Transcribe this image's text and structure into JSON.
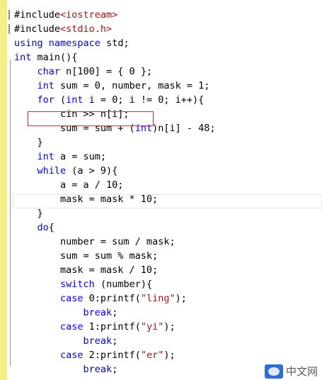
{
  "editor": {
    "lines": [
      [
        {
          "t": "#include"
        },
        {
          "t": "<iostream>",
          "c": "str"
        }
      ],
      [
        {
          "t": "#include"
        },
        {
          "t": "<stdio.h>",
          "c": "str"
        }
      ],
      [
        {
          "t": "using",
          "c": "kw"
        },
        {
          "t": " "
        },
        {
          "t": "namespace",
          "c": "kw"
        },
        {
          "t": " std;"
        }
      ],
      [
        {
          "t": "int",
          "c": "kw"
        },
        {
          "t": " main(){"
        }
      ],
      [
        {
          "t": "    "
        },
        {
          "t": "char",
          "c": "kw"
        },
        {
          "t": " n[100] = { 0 };"
        }
      ],
      [
        {
          "t": "    "
        },
        {
          "t": "int",
          "c": "kw"
        },
        {
          "t": " sum = 0, number, mask = 1;"
        }
      ],
      [
        {
          "t": "    "
        },
        {
          "t": "for",
          "c": "kw"
        },
        {
          "t": " ("
        },
        {
          "t": "int",
          "c": "kw"
        },
        {
          "t": " i = 0; i != 0; i++){"
        }
      ],
      [
        {
          "t": "        cin >> n[i];"
        }
      ],
      [
        {
          "t": "        sum = sum + ("
        },
        {
          "t": "int",
          "c": "kw"
        },
        {
          "t": ")n[i] - 48;"
        }
      ],
      [
        {
          "t": "    }"
        }
      ],
      [
        {
          "t": "    "
        },
        {
          "t": "int",
          "c": "kw"
        },
        {
          "t": " a = sum;"
        }
      ],
      [
        {
          "t": "    "
        },
        {
          "t": "while",
          "c": "kw"
        },
        {
          "t": " (a > 9){"
        }
      ],
      [
        {
          "t": "        a = a / 10;"
        }
      ],
      [
        {
          "t": "        mask = mask * 10;"
        }
      ],
      [
        {
          "t": "    }"
        }
      ],
      [
        {
          "t": "    "
        },
        {
          "t": "do",
          "c": "kw"
        },
        {
          "t": "{"
        }
      ],
      [
        {
          "t": "        number = sum / mask;"
        }
      ],
      [
        {
          "t": "        sum = sum % mask;"
        }
      ],
      [
        {
          "t": "        mask = mask / 10;"
        }
      ],
      [
        {
          "t": "        "
        },
        {
          "t": "switch",
          "c": "kw"
        },
        {
          "t": " (number){"
        }
      ],
      [
        {
          "t": "        "
        },
        {
          "t": "case",
          "c": "kw"
        },
        {
          "t": " 0:printf("
        },
        {
          "t": "\"ling\"",
          "c": "str"
        },
        {
          "t": ");"
        }
      ],
      [
        {
          "t": "            "
        },
        {
          "t": "break",
          "c": "kw"
        },
        {
          "t": ";"
        }
      ],
      [
        {
          "t": "        "
        },
        {
          "t": "case",
          "c": "kw"
        },
        {
          "t": " 1:printf("
        },
        {
          "t": "\"yi\"",
          "c": "str"
        },
        {
          "t": ");"
        }
      ],
      [
        {
          "t": "            "
        },
        {
          "t": "break",
          "c": "kw"
        },
        {
          "t": ";"
        }
      ],
      [
        {
          "t": "        "
        },
        {
          "t": "case",
          "c": "kw"
        },
        {
          "t": " 2:printf("
        },
        {
          "t": "\"er\"",
          "c": "str"
        },
        {
          "t": ");"
        }
      ],
      [
        {
          "t": "            "
        },
        {
          "t": "break",
          "c": "kw"
        },
        {
          "t": ";"
        }
      ]
    ]
  },
  "watermark": {
    "logo_icon": "php-logo-icon",
    "text": "中文网"
  },
  "colors": {
    "keyword": "#0000ff",
    "string": "#a31515",
    "gutter": "#f3ef86",
    "highlight_box": "#e0262c"
  }
}
